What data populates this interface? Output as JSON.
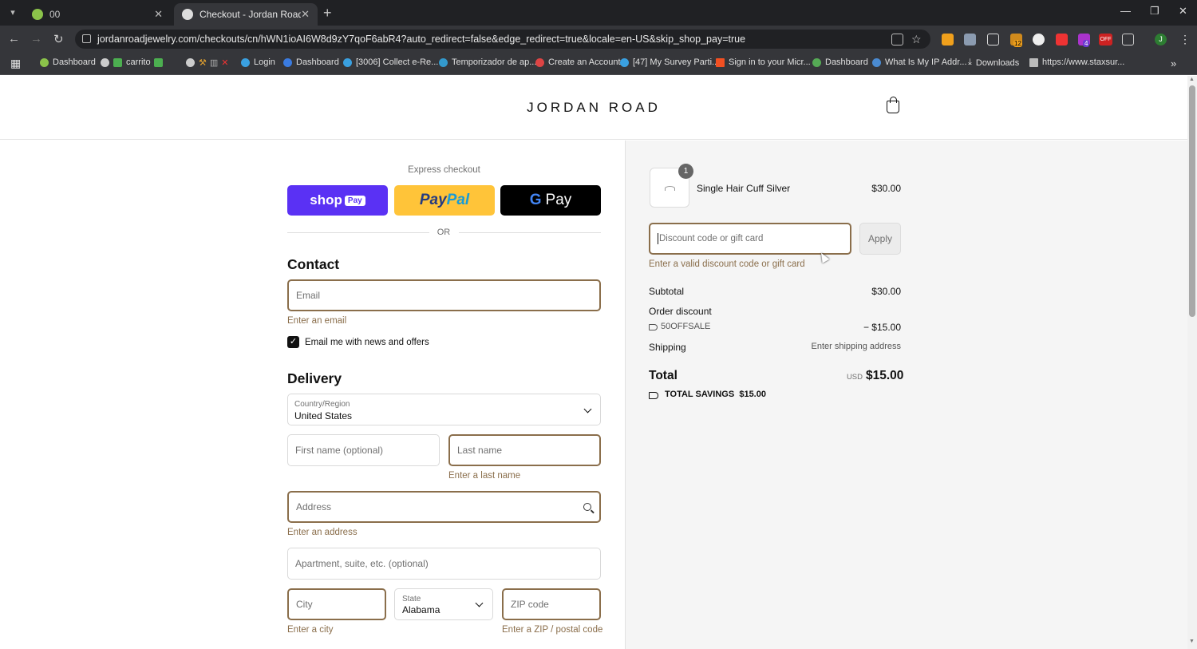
{
  "browser": {
    "tabs": [
      {
        "title": "00",
        "active": false
      },
      {
        "title": "Checkout - Jordan Road",
        "active": true
      }
    ],
    "url": "jordanroadjewelry.com/checkouts/cn/hWN1ioAI6W8d9zY7qoF6abR4?auto_redirect=false&edge_redirect=true&locale=en-US&skip_shop_pay=true",
    "bookmarks": [
      "Dashboard",
      "carrito",
      "",
      "Login",
      "Dashboard",
      "[3006] Collect e-Re...",
      "Temporizador de ap...",
      "Create an Account",
      "[47] My Survey Parti...",
      "Sign in to your Micr...",
      "Dashboard",
      "What Is My IP Addr...",
      "Downloads",
      "https://www.staxsur..."
    ],
    "ext_badges": {
      "badge_12": "12",
      "badge_4": "4",
      "badge_off": "OFF"
    },
    "profile_initial": "J"
  },
  "store": {
    "logo": "JORDAN ROAD"
  },
  "express": {
    "label": "Express checkout",
    "shoppay": "shop",
    "shoppay_badge": "Pay",
    "paypal_a": "Pay",
    "paypal_b": "Pal",
    "gpay_g": "G",
    "gpay": "Pay",
    "or": "OR"
  },
  "contact": {
    "heading": "Contact",
    "email_placeholder": "Email",
    "email_error": "Enter an email",
    "newsletter_label": "Email me with news and offers",
    "newsletter_checked": true
  },
  "delivery": {
    "heading": "Delivery",
    "country_label": "Country/Region",
    "country_value": "United States",
    "first_name_placeholder": "First name (optional)",
    "last_name_placeholder": "Last name",
    "last_name_error": "Enter a last name",
    "address_placeholder": "Address",
    "address_error": "Enter an address",
    "apartment_placeholder": "Apartment, suite, etc. (optional)",
    "city_placeholder": "City",
    "city_error": "Enter a city",
    "state_label": "State",
    "state_value": "Alabama",
    "zip_placeholder": "ZIP code",
    "zip_error": "Enter a ZIP / postal code"
  },
  "summary": {
    "item": {
      "quantity": "1",
      "name": "Single Hair Cuff Silver",
      "price": "$30.00"
    },
    "discount_placeholder": "Discount code or gift card",
    "apply_label": "Apply",
    "discount_error": "Enter a valid discount code or gift card",
    "subtotal_label": "Subtotal",
    "subtotal_value": "$30.00",
    "order_discount_label": "Order discount",
    "discount_code": "50OFFSALE",
    "discount_value": "− $15.00",
    "shipping_label": "Shipping",
    "shipping_value": "Enter shipping address",
    "total_label": "Total",
    "total_currency": "USD",
    "total_value": "$15.00",
    "savings_label": "TOTAL SAVINGS",
    "savings_value": "$15.00"
  },
  "colors": {
    "error_brown": "#8a6e4b",
    "shoppay_purple": "#5a31f4",
    "paypal_yellow": "#ffc439",
    "gpay_black": "#000000"
  }
}
